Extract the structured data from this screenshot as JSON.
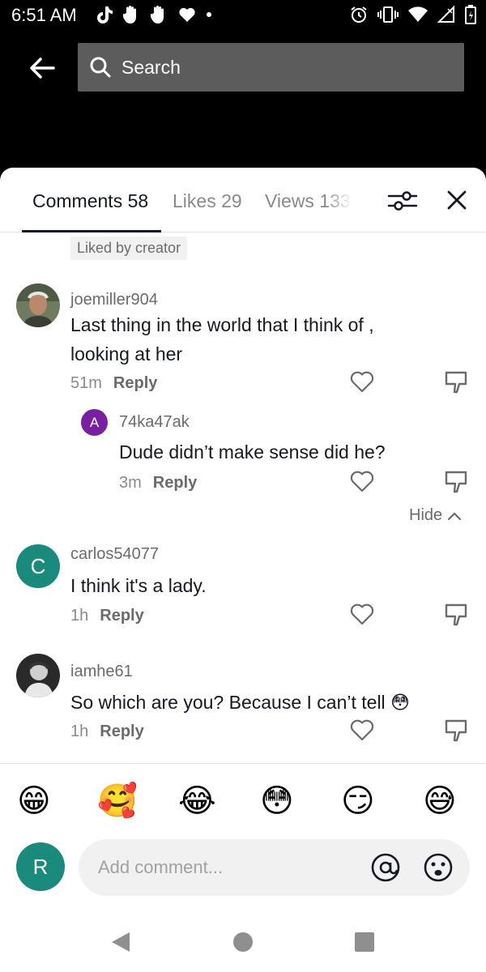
{
  "status_bar": {
    "time": "6:51 AM",
    "left_icons": [
      "tiktok-icon",
      "hand-icon",
      "hand-icon",
      "heart-icon",
      "dot-icon"
    ],
    "right_icons": [
      "alarm-icon",
      "vibrate-icon",
      "wifi-icon",
      "signal-icon",
      "battery-icon"
    ]
  },
  "search": {
    "placeholder": "Search"
  },
  "tabs": [
    {
      "label": "Comments 58",
      "active": true
    },
    {
      "label": "Likes 29",
      "active": false
    },
    {
      "label": "Views 133",
      "active": false
    }
  ],
  "liked_badge": "Liked by creator",
  "comments": [
    {
      "username": "joemiller904",
      "text_line1": "Last thing in the world that I think of ,",
      "text_line2": "looking at her",
      "time": "51m",
      "reply": "Reply"
    },
    {
      "avatar_letter": "A",
      "username": "74ka47ak",
      "text": "Dude didn’t make sense did he?",
      "time": "3m",
      "reply": "Reply",
      "avatar_color": "#7a1fa2"
    },
    {
      "avatar_letter": "C",
      "username": "carlos54077",
      "text": "I think it's a lady.",
      "time": "1h",
      "reply": "Reply",
      "avatar_color": "#1a8a7c"
    },
    {
      "username": "iamhe61",
      "text": "So which are you? Because I can’t tell 😳",
      "time": "1h",
      "reply": "Reply"
    }
  ],
  "hide_label": "Hide",
  "emoji_bar": [
    "😁",
    "🥰",
    "😂",
    "😳",
    "😏",
    "😅"
  ],
  "composer": {
    "avatar_letter": "R",
    "placeholder": "Add comment...",
    "avatar_color": "#1a8a7c"
  }
}
